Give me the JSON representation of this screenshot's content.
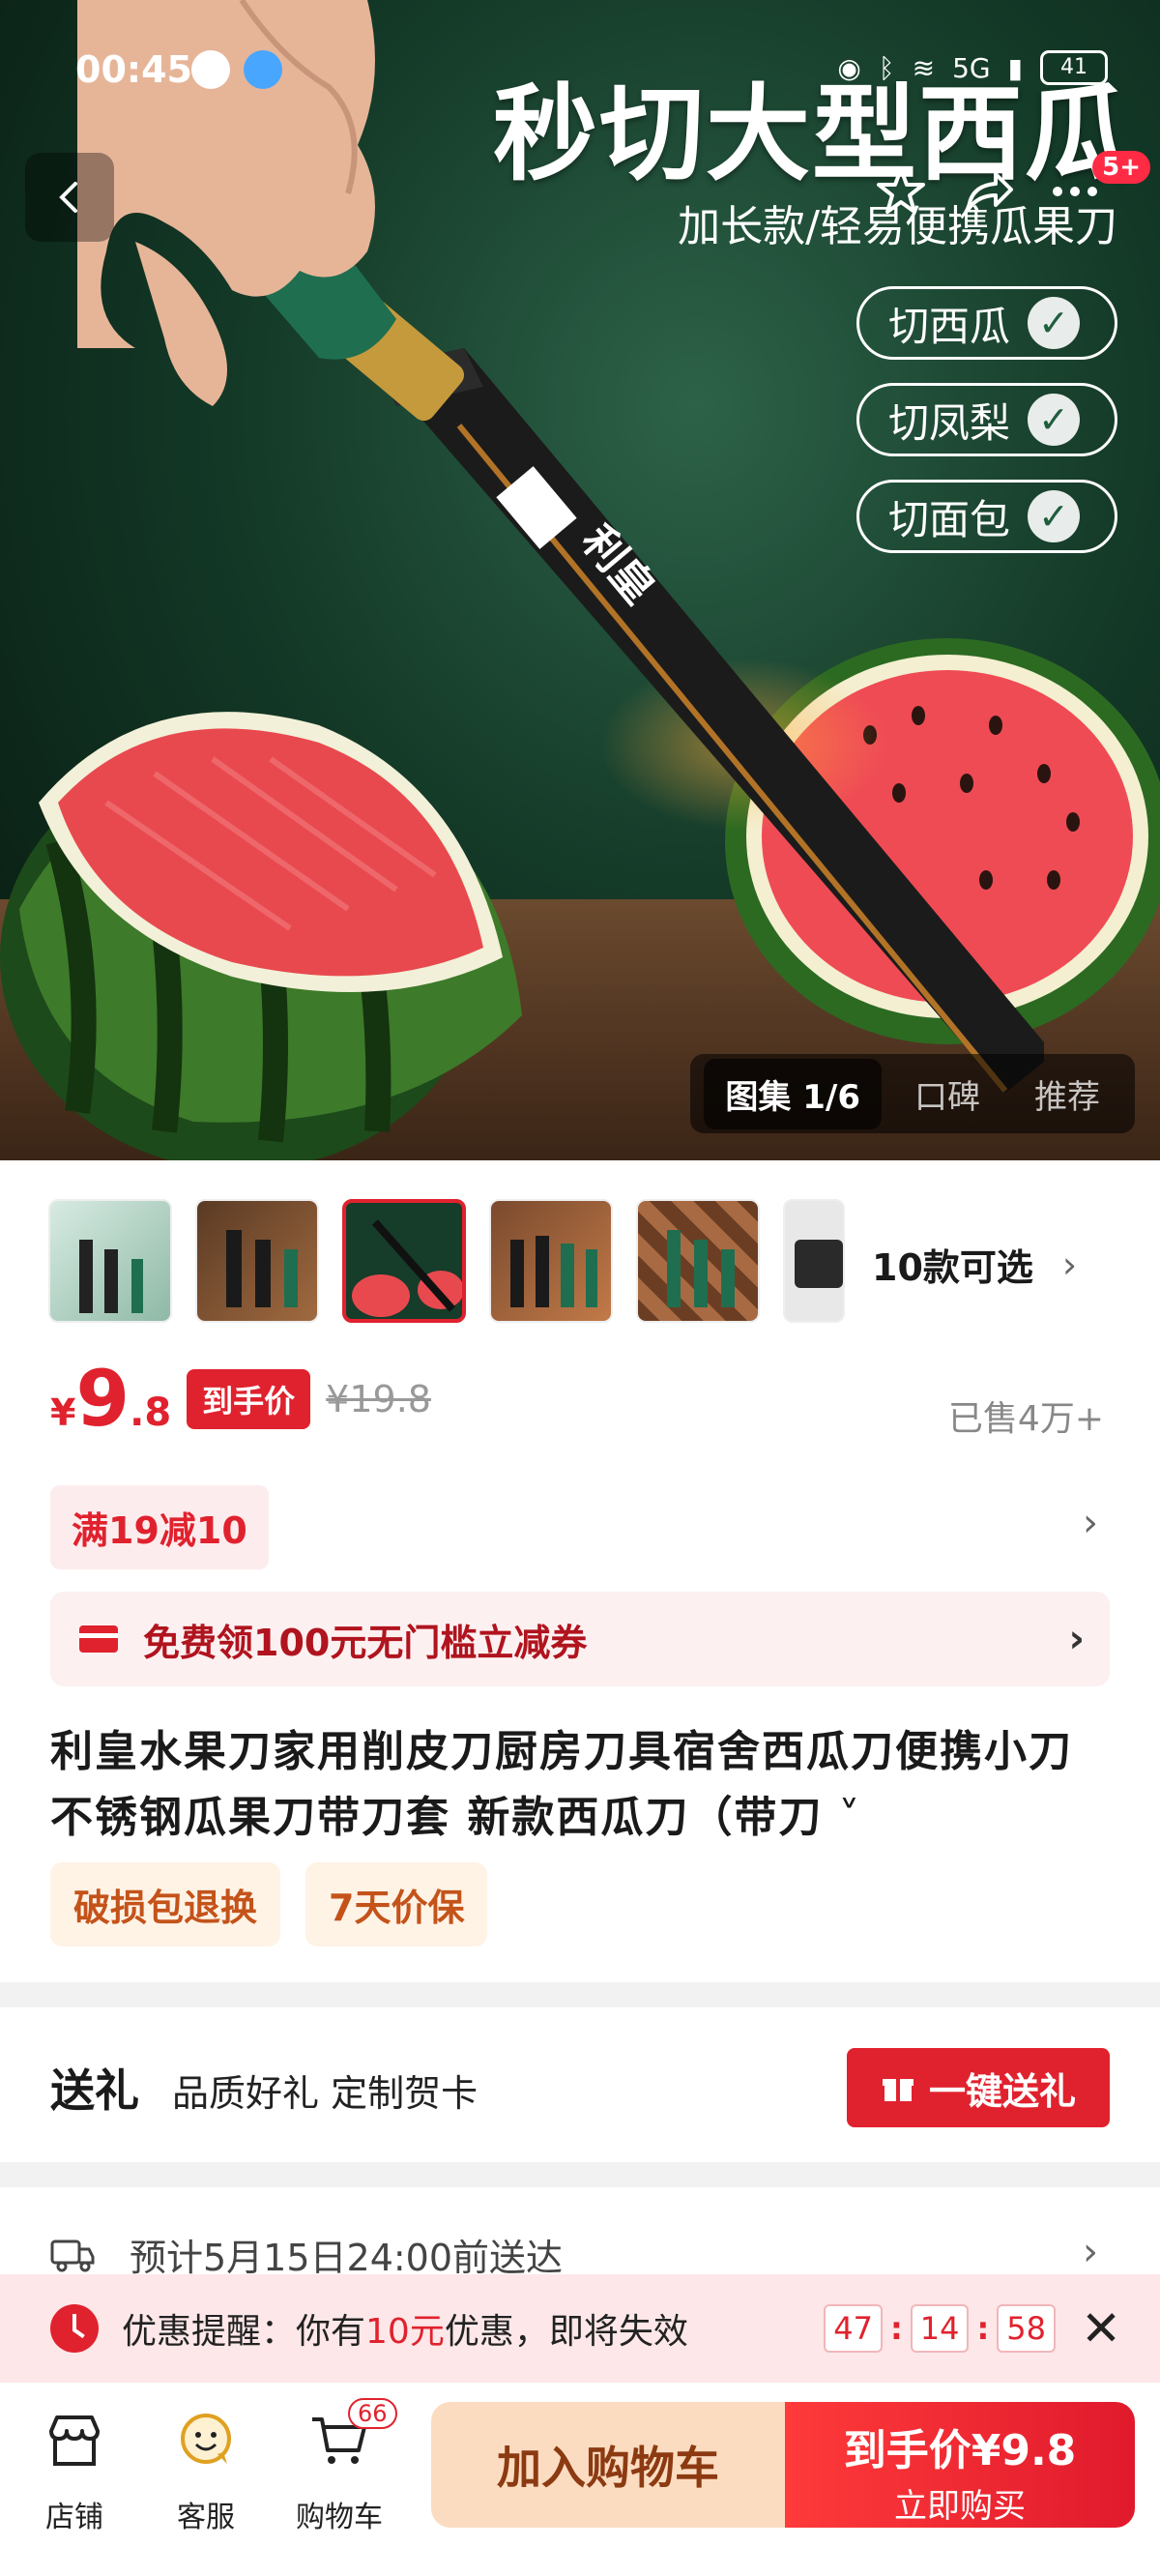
{
  "status_bar": {
    "time": "00:45",
    "network": "5G",
    "battery": "41"
  },
  "hero": {
    "headline": "秒切大型西瓜",
    "subline": "加长款/轻易便携瓜果刀",
    "features": [
      "切西瓜",
      "切凤梨",
      "切面包"
    ],
    "more_badge": "5+",
    "gallery_tabs": [
      "图集 1/6",
      "口碑",
      "推荐"
    ]
  },
  "variants": {
    "label": "10款可选"
  },
  "price": {
    "currency": "¥",
    "integer": "9",
    "decimal": ".8",
    "tag": "到手价",
    "original": "¥19.8",
    "sold": "已售4万+"
  },
  "promotion": {
    "label": "满19减10"
  },
  "coupon": {
    "label": "免费领100元无门槛立减券"
  },
  "product": {
    "title": "利皇水果刀家用削皮刀厨房刀具宿舍西瓜刀便携小刀不锈钢瓜果刀带刀套 新款西瓜刀（带刀",
    "service_tags": [
      "破损包退换",
      "7天价保"
    ]
  },
  "gift": {
    "title": "送礼",
    "subtitle": "品质好礼 定制贺卡",
    "button": "一键送礼"
  },
  "delivery": {
    "text": "预计5月15日24:00前送达"
  },
  "reminder": {
    "prefix": "优惠提醒：你有",
    "amount": "10元",
    "suffix": "优惠，即将失效",
    "countdown": [
      "47",
      "14",
      "58"
    ]
  },
  "bottom_bar": {
    "store": "店铺",
    "service": "客服",
    "cart": "购物车",
    "cart_count": "66",
    "add_to_cart": "加入购物车",
    "buy_price": "到手价¥9.8",
    "buy_label": "立即购买"
  },
  "colors": {
    "accent": "#e0222e",
    "hero_bg": "#143a28",
    "add_cart_bg": "#fbdcc0"
  }
}
